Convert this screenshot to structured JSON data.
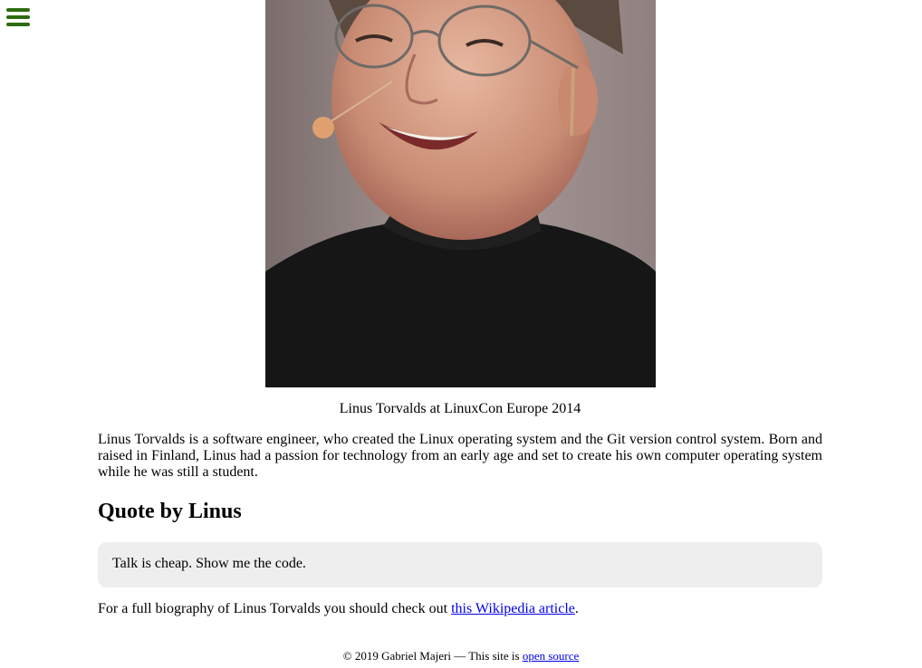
{
  "nav": {
    "menu_icon": "hamburger-menu-icon",
    "menu_color": "#2e6b0f"
  },
  "figure": {
    "caption": "Linus Torvalds at LinuxCon Europe 2014"
  },
  "intro": {
    "text": "Linus Torvalds is a software engineer, who created the Linux operating system and the Git version control system. Born and raised in Finland, Linus had a passion for technology from an early age and set to create his own computer operating system while he was still a student."
  },
  "quote": {
    "heading": "Quote by Linus",
    "text": "Talk is cheap. Show me the code.",
    "box_color": "#eeeeee"
  },
  "biography": {
    "prefix": "For a full biography of Linus Torvalds you should check out ",
    "link_text": "this Wikipedia article",
    "suffix": "."
  },
  "footer": {
    "prefix": "© 2019 Gabriel Majeri — This site is ",
    "link_text": "open source"
  }
}
